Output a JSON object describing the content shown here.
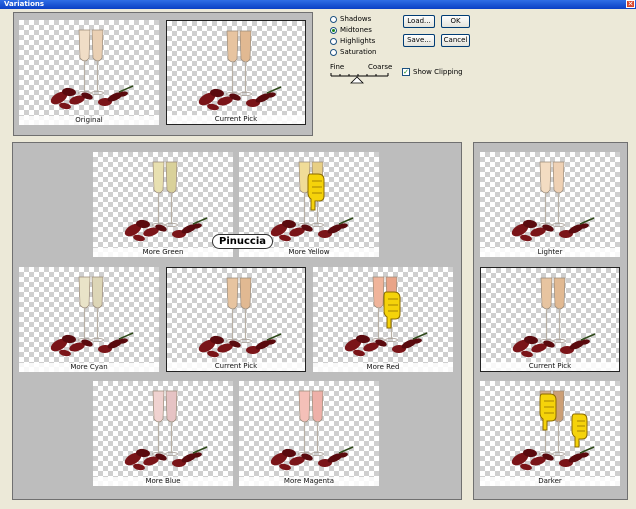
{
  "window": {
    "title": "Variations",
    "close_glyph": "✕"
  },
  "controls": {
    "tones": [
      {
        "label": "Shadows",
        "selected": false
      },
      {
        "label": "Midtones",
        "selected": true
      },
      {
        "label": "Highlights",
        "selected": false
      },
      {
        "label": "Saturation",
        "selected": false
      }
    ],
    "scale_fine": "Fine",
    "scale_coarse": "Coarse",
    "show_clipping_label": "Show Clipping",
    "show_clipping_checked": true,
    "buttons": {
      "load": "Load...",
      "ok": "OK",
      "save": "Save...",
      "cancel": "Cancel"
    }
  },
  "top_thumbs": {
    "original": "Original",
    "current_pick": "Current Pick"
  },
  "color_thumbs": {
    "more_green": "More Green",
    "more_yellow": "More Yellow",
    "more_cyan": "More Cyan",
    "current_pick": "Current Pick",
    "more_red": "More Red",
    "more_blue": "More Blue",
    "more_magenta": "More Magenta"
  },
  "brightness_thumbs": {
    "lighter": "Lighter",
    "current_pick": "Current Pick",
    "darker": "Darker"
  },
  "watermark": "Pinuccia",
  "colors": {
    "glass_wine": "#e9c7a6",
    "petal": "#6a0f12",
    "hand": "#f5d30a"
  }
}
